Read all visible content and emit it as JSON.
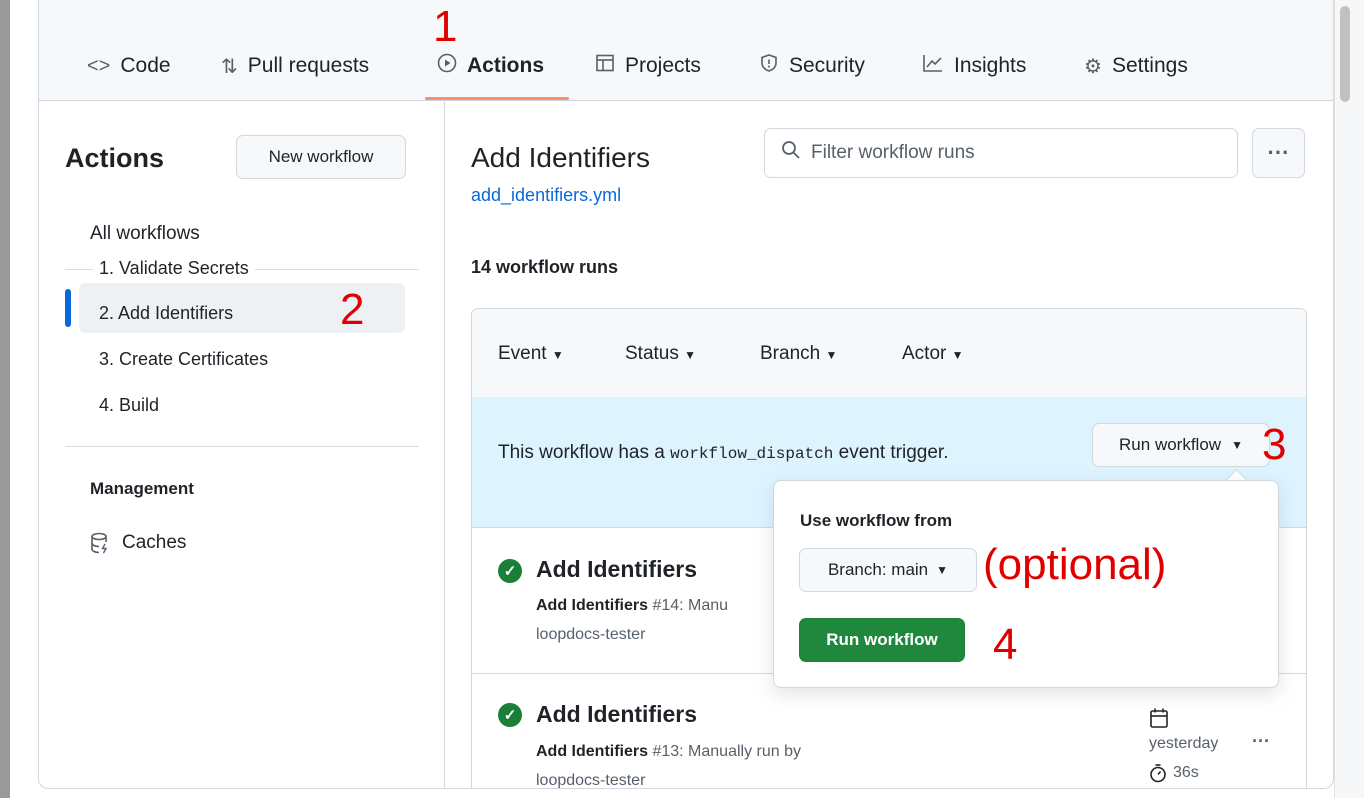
{
  "tabs": [
    {
      "label": "Code",
      "icon": "code-icon"
    },
    {
      "label": "Pull requests",
      "icon": "pull-request-icon"
    },
    {
      "label": "Actions",
      "icon": "play-icon"
    },
    {
      "label": "Projects",
      "icon": "table-icon"
    },
    {
      "label": "Security",
      "icon": "shield-icon"
    },
    {
      "label": "Insights",
      "icon": "graph-icon"
    },
    {
      "label": "Settings",
      "icon": "gear-icon"
    }
  ],
  "annotations": {
    "a1": "1",
    "a2": "2",
    "a3": "3",
    "a4": "4",
    "optional": "(optional)"
  },
  "sidebar": {
    "title": "Actions",
    "new_workflow": "New workflow",
    "all_workflows": "All workflows",
    "items": [
      "1. Validate Secrets",
      "2. Add Identifiers",
      "3. Create Certificates",
      "4. Build"
    ],
    "management": "Management",
    "caches": "Caches"
  },
  "main": {
    "title": "Add Identifiers",
    "file_link": "add_identifiers.yml",
    "filter_placeholder": "Filter workflow runs",
    "more": "···",
    "runs_count": "14 workflow runs",
    "filters": [
      "Event",
      "Status",
      "Branch",
      "Actor"
    ],
    "banner_pre": "This workflow has a",
    "banner_code": "workflow_dispatch",
    "banner_post": "event trigger.",
    "run_workflow": "Run workflow",
    "runs": [
      {
        "title": "Add Identifiers",
        "name": "Add Identifiers",
        "desc": "#14: Manu",
        "actor": "loopdocs-tester"
      },
      {
        "title": "Add Identifiers",
        "name": "Add Identifiers",
        "desc": "#13: Manually run by",
        "actor": "loopdocs-tester",
        "when": "yesterday",
        "duration": "36s",
        "more": "···"
      }
    ]
  },
  "dropdown": {
    "label": "Use workflow from",
    "branch": "Branch: main",
    "run_button": "Run workflow"
  },
  "colors": {
    "accent": "#0969da",
    "green": "#1f883d",
    "banner": "#ddf4ff",
    "annotation": "#e00000",
    "underline": "#fd8c73"
  }
}
